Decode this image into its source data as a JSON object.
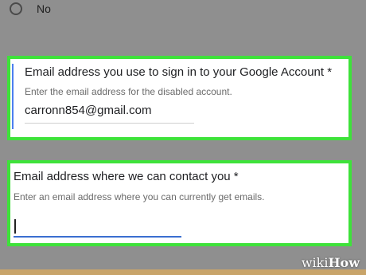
{
  "radio_option": {
    "label": "No",
    "selected": false
  },
  "question_1": {
    "title": "Email address you use to sign in to your Google Account *",
    "description": "Enter the email address for the disabled account.",
    "value": "carronn854@gmail.com"
  },
  "question_2": {
    "title": "Email address where we can contact you *",
    "description": "Enter an email address where you can currently get emails.",
    "value": ""
  },
  "watermark": {
    "wiki": "wiki",
    "how": "How"
  },
  "colors": {
    "highlight_border": "#3ee23a",
    "focus_accent": "#4c7ff0",
    "active_underline": "#3b6fd1",
    "backdrop": "#8f8f8f"
  }
}
